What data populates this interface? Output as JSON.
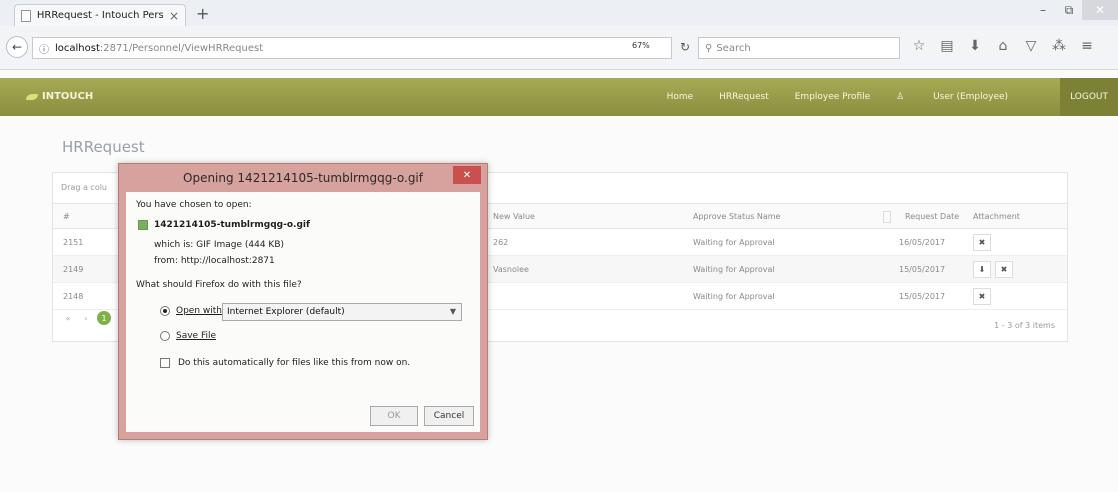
{
  "browser": {
    "tab_title": "HRRequest - Intouch Person",
    "tab_close": "×",
    "new_tab": "+",
    "url_host": "localhost",
    "url_rest": ":2871/Personnel/ViewHRRequest",
    "zoom": "67%",
    "search_placeholder": "Search",
    "icons": [
      "bookmark-star-icon",
      "library-icon",
      "download-icon",
      "home-icon",
      "pocket-icon",
      "extensions-icon",
      "menu-icon"
    ]
  },
  "app": {
    "brand": "INTOUCH",
    "nav": [
      "Home",
      "HRRequest",
      "Employee Profile",
      "User (Employee)"
    ],
    "logout": "LOGOUT",
    "page_title": "HRRequest"
  },
  "grid": {
    "group_hint": "Drag a colu",
    "headers": [
      "#",
      "New Value",
      "Approve Status Name",
      "Request Date",
      "Attachment"
    ],
    "rows": [
      {
        "id": "2151",
        "new_value": "262",
        "status": "Waiting for Approval",
        "date": "16/05/2017"
      },
      {
        "id": "2149",
        "new_value": "Vasnolee",
        "status": "Waiting for Approval",
        "date": "15/05/2017"
      },
      {
        "id": "2148",
        "new_value": "",
        "status": "Waiting for Approval",
        "date": "15/05/2017"
      }
    ],
    "pager_current": "1",
    "items_count": "1 - 3 of 3 items"
  },
  "dialog": {
    "title": "Opening 1421214105-tumblrmgqg-o.gif",
    "chosen_label": "You have chosen to open:",
    "file_name": "1421214105-tumblrmgqg-o.gif",
    "which_is": "which is:  GIF Image (444 KB)",
    "from": "from:  http://localhost:2871",
    "question": "What should Firefox do with this file?",
    "open_with_label": "Open with",
    "open_with_value": "Internet Explorer (default)",
    "save_file_label": "Save File",
    "auto_label": "Do this automatically for files like this from now on.",
    "ok_label": "OK",
    "cancel_label": "Cancel"
  }
}
